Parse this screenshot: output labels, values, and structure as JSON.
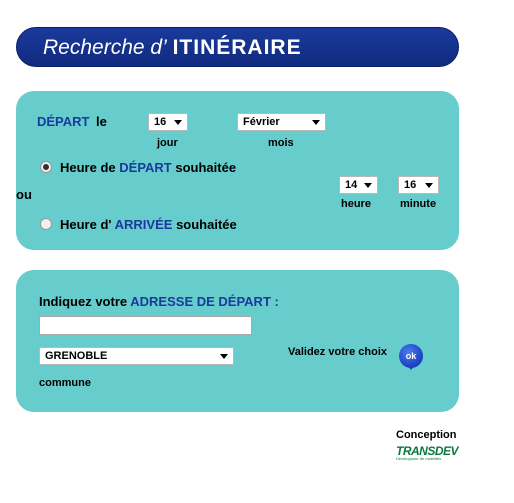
{
  "banner": {
    "prefix": "Recherche d’",
    "title": "ITINÉRAIRE"
  },
  "date": {
    "depart_word": "DÉPART",
    "le_word": "le",
    "day_value": "16",
    "day_label": "jour",
    "month_value": "Février",
    "month_label": "mois"
  },
  "time_mode": {
    "option_depart": {
      "prefix": "Heure de",
      "highlight": "DÉPART",
      "suffix": "souhaitée",
      "selected": true
    },
    "or_word": "ou",
    "option_arrivee": {
      "prefix": "Heure d'",
      "highlight": "ARRIVÉE",
      "suffix": "souhaitée",
      "selected": false
    },
    "hour_value": "14",
    "hour_label": "heure",
    "minute_value": "16",
    "minute_label": "minute"
  },
  "address": {
    "prompt": "Indiquez votre",
    "prompt_highlight": "ADRESSE DE DÉPART :",
    "input_value": "",
    "commune_value": "GRENOBLE",
    "commune_label": "commune",
    "validate_text": "Validez votre choix",
    "ok_label": "ok"
  },
  "footer": {
    "conception": "Conception",
    "brand": "TRANSDEV",
    "brand_tagline": "Développeur de mobilités"
  },
  "colors": {
    "banner": "#1a3a9c",
    "panel": "#66cccc",
    "accent_text": "#1a3a9c",
    "logo": "#0b7a3e"
  }
}
